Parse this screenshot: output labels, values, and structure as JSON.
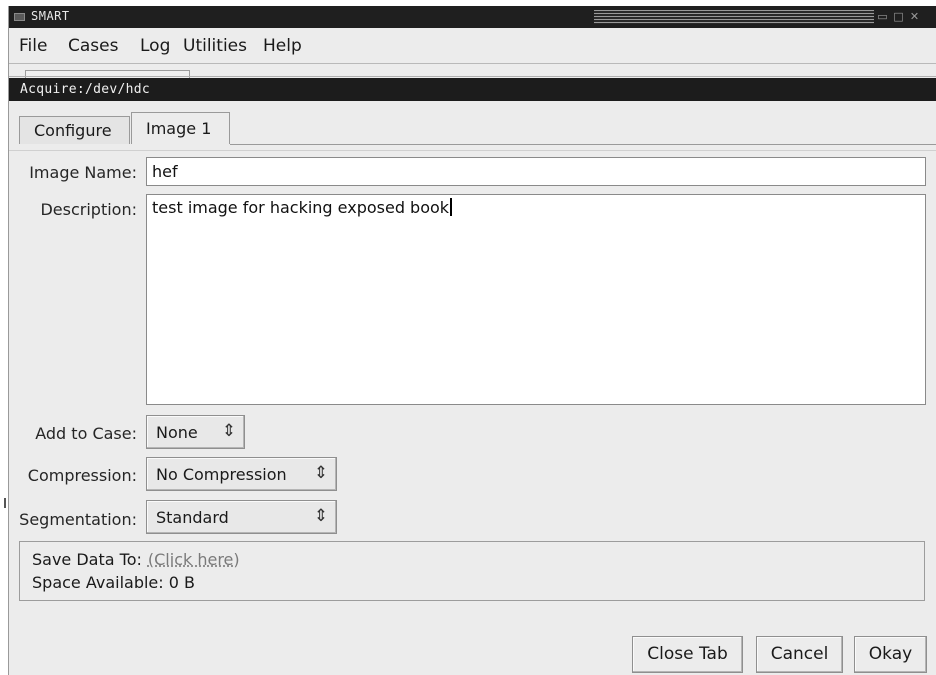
{
  "window": {
    "title": "SMART",
    "icons": [
      "app-menu-icon",
      "minimize-icon",
      "maximize-icon",
      "close-icon"
    ]
  },
  "menubar": {
    "items": [
      "File",
      "Cases",
      "Log",
      "Utilities",
      "Help"
    ]
  },
  "acquire_bar": {
    "text": "Acquire:/dev/hdc"
  },
  "tabs": [
    {
      "label": "Configure",
      "active": false
    },
    {
      "label": "Image 1",
      "active": true
    }
  ],
  "form": {
    "image_name": {
      "label": "Image Name:",
      "value": "hef"
    },
    "description": {
      "label": "Description:",
      "value": "test image for hacking exposed book"
    },
    "add_to_case": {
      "label": "Add to Case:",
      "value": "None"
    },
    "compression": {
      "label": "Compression:",
      "value": "No Compression"
    },
    "segmentation": {
      "label": "Segmentation:",
      "value": "Standard"
    }
  },
  "save_panel": {
    "save_label": "Save Data To:",
    "save_link": "(Click here)",
    "space_label": "Space Available:",
    "space_value": "0 B"
  },
  "buttons": {
    "close_tab": "Close Tab",
    "cancel": "Cancel",
    "okay": "Okay"
  },
  "colors": {
    "title_bar": "#1f1f1f",
    "acquire_bar": "#1c1c1c",
    "window_bg": "#ececec",
    "link": "#7a7a7a"
  }
}
